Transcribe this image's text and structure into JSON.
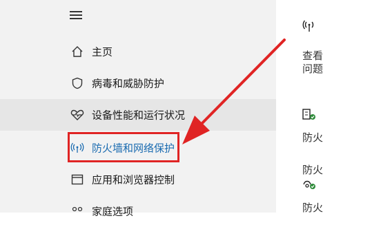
{
  "sidebar": {
    "items": [
      {
        "label": "主页",
        "icon": "home-icon"
      },
      {
        "label": "病毒和威胁防护",
        "icon": "shield-icon"
      },
      {
        "label": "设备性能和运行状况",
        "icon": "heart-icon"
      },
      {
        "label": "防火墙和网络保护",
        "icon": "wifi-antenna-icon"
      },
      {
        "label": "应用和浏览器控制",
        "icon": "app-window-icon"
      },
      {
        "label": "家庭选项",
        "icon": "family-icon"
      }
    ]
  },
  "main": {
    "text_1": "查看",
    "text_2": "问题",
    "text_3": "防火",
    "text_4": "防火",
    "text_5": "防火"
  },
  "colors": {
    "active": "#1a6bb0",
    "annotation": "#e02424",
    "sidebar_bg": "#f2f2f2",
    "hover_bg": "#e6e6e6",
    "status_ok": "#2e8b3a"
  }
}
